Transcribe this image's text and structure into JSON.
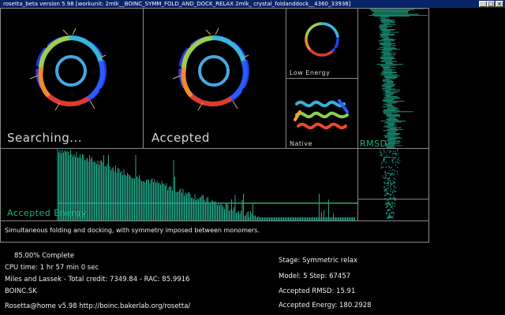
{
  "window": {
    "title": "rosetta_beta version 5.98 [workunit: 2mlk__BOINC_SYMM_FOLD_AND_DOCK_RELAX 2mlk_ crystal_foldanddock__4360_33938]",
    "minimize_label": "_",
    "maximize_label": "□",
    "close_label": "×"
  },
  "panels": {
    "searching": "Searching...",
    "accepted": "Accepted",
    "low_energy": "Low Energy",
    "native": "Native",
    "rmsd": "RMSD",
    "accepted_energy": "Accepted Energy"
  },
  "description": "Simultaneous folding and docking, with symmetry imposed between monomers.",
  "status_left": {
    "complete": "85.00% Complete",
    "cpu_time": "CPU time: 1 hr 57 min 0 sec",
    "user_line": "Miles and Lassek - Total credit: 7349.84 - RAC: 85.9916",
    "team": "BOINC.SK",
    "footer": "Rosetta@home  v5.98  http://boinc.bakerlab.org/rosetta/"
  },
  "status_right": {
    "stage": "Stage: Symmetric relax",
    "model_step": "Model: 5   Step: 67457",
    "accepted_rmsd": "Accepted RMSD:   15.91",
    "accepted_energy": "Accepted Energy:   180.2928"
  },
  "colors": {
    "trace": "#1fa98a",
    "frame": "#8a8a8a",
    "title_bg": "#0a246a"
  },
  "icons": {
    "searching_view": "protein-ribbon-icon",
    "accepted_view": "protein-ribbon-icon",
    "low_energy_view": "protein-ribbon-icon",
    "native_view": "protein-ribbon-icon"
  }
}
